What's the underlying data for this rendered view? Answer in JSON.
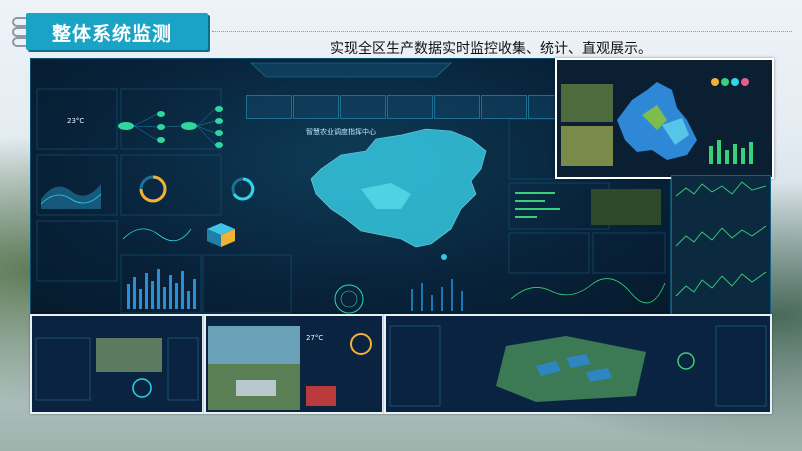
{
  "slide": {
    "title": "整体系统监测",
    "subtitle": "实现全区生产数据实时监控收集、统计、直观展示。"
  },
  "dashboard": {
    "header": "智慧农业调度指挥中心",
    "weather_temp": "23°C",
    "overlay_temp": "27°C"
  },
  "colors": {
    "accent": "#1aa3c4",
    "dashboard_bg": "#08223a",
    "map_cyan": "#2fd6e8",
    "chart_green": "#3ad07a"
  }
}
